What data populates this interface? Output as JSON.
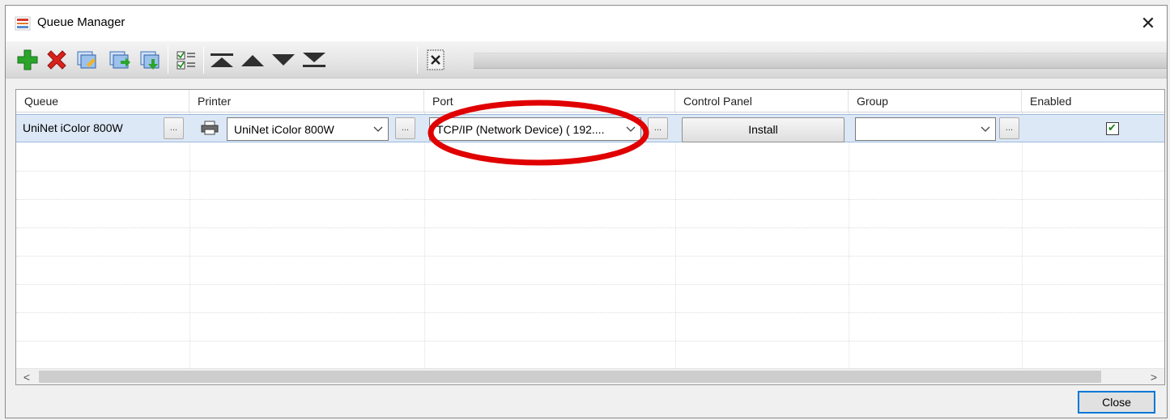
{
  "window": {
    "title": "Queue Manager",
    "close_glyph": "✕"
  },
  "toolbar": {
    "buttons": [
      {
        "icon": "add-icon"
      },
      {
        "icon": "delete-icon"
      },
      {
        "icon": "copy-queue-icon"
      },
      {
        "icon": "export-queue-icon"
      },
      {
        "icon": "import-queue-icon"
      },
      {
        "icon": "checklist-icon"
      },
      {
        "icon": "move-top-icon"
      },
      {
        "icon": "move-up-icon"
      },
      {
        "icon": "move-down-icon"
      },
      {
        "icon": "move-bottom-icon"
      },
      {
        "icon": "clear-icon"
      }
    ]
  },
  "grid": {
    "columns": [
      "Queue",
      "Printer",
      "Port",
      "Control Panel",
      "Group",
      "Enabled"
    ],
    "rows": [
      {
        "queue": "UniNet iColor 800W",
        "queue_more": "...",
        "printer": "UniNet iColor 800W",
        "printer_more": "...",
        "port": "TCP/IP (Network Device) ( 192....",
        "port_more": "...",
        "control_panel": "Install",
        "group": "",
        "group_more": "...",
        "enabled": true,
        "enabled_glyph": "✔"
      }
    ],
    "scroll_left": "<",
    "scroll_right": ">"
  },
  "footer": {
    "close_label": "Close"
  },
  "colors": {
    "selection": "#dce8f6",
    "annotation": "#e00000",
    "accent": "#0078d7"
  }
}
